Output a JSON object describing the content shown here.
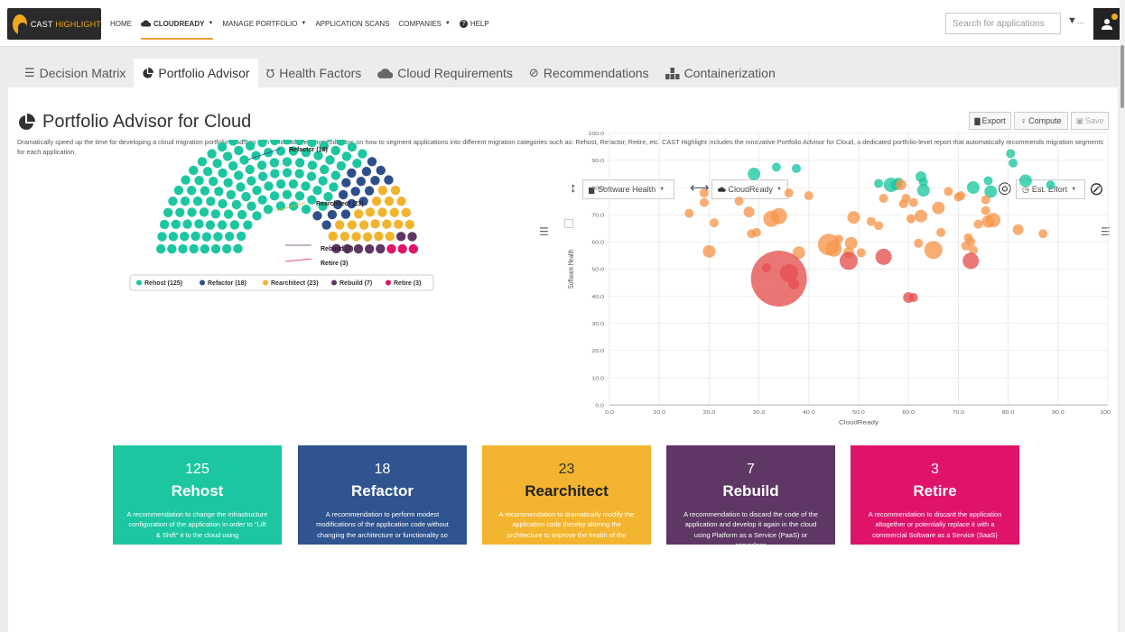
{
  "app": {
    "logo_text_a": "CAST",
    "logo_text_b": "HIGHLIGHT"
  },
  "nav": {
    "items": [
      {
        "label": "HOME",
        "dropdown": false
      },
      {
        "label": "CLOUDREADY",
        "dropdown": true,
        "active": true
      },
      {
        "label": "MANAGE PORTFOLIO",
        "dropdown": true
      },
      {
        "label": "APPLICATION SCANS",
        "dropdown": false
      },
      {
        "label": "COMPANIES",
        "dropdown": true
      },
      {
        "label": "HELP",
        "dropdown": false
      }
    ],
    "search_placeholder": "Search for applications",
    "filter_label": "…"
  },
  "tabs": [
    {
      "label": "Decision Matrix",
      "icon": "sliders-icon"
    },
    {
      "label": "Portfolio Advisor",
      "icon": "pie-icon",
      "active": true
    },
    {
      "label": "Health Factors",
      "icon": "stethoscope-icon"
    },
    {
      "label": "Cloud Requirements",
      "icon": "cloud-icon"
    },
    {
      "label": "Recommendations",
      "icon": "check-circle-icon"
    },
    {
      "label": "Containerization",
      "icon": "container-icon"
    }
  ],
  "page": {
    "title": "Portfolio Advisor for Cloud",
    "description": "Dramatically speed up the time for developing a cloud migration portfolio roadmap with automatic recommendations on how to segment applications into different migration categories such as: Rehost, Refactor, Retire, etc. CAST Highlight includes the innovative Portfolio Advisor for Cloud, a dedicated portfolio-level report that automatically recommends migration segments for each application.",
    "export_label": "Export",
    "compute_label": "Compute",
    "save_label": "Save"
  },
  "controls": {
    "y_axis_select": "Software Health",
    "x_axis_select": "CloudReady",
    "size_select": "Est. Effort"
  },
  "colors": {
    "rehost": "#1cc6a0",
    "refactor": "#2f4f8c",
    "rearchitect": "#f1b42f",
    "rebuild": "#5e3764",
    "retire": "#e0136b"
  },
  "chart_data": [
    {
      "type": "parliament",
      "series": [
        {
          "name": "Rehost",
          "label": "Rehost (125)",
          "value": 125
        },
        {
          "name": "Refactor",
          "label": "Refactor (18)",
          "value": 18
        },
        {
          "name": "Rearchitect",
          "label": "Rearchitect (23)",
          "value": 23
        },
        {
          "name": "Rebuild",
          "label": "Rebuild (7)",
          "value": 7
        },
        {
          "name": "Retire",
          "label": "Retire (3)",
          "value": 3
        }
      ],
      "legend": "bottom"
    },
    {
      "type": "scatter",
      "xlabel": "CloudReady",
      "ylabel": "Software Health",
      "xlim": [
        0,
        100
      ],
      "ylim": [
        0,
        100
      ],
      "xticks": [
        "0.0",
        "10.0",
        "20.0",
        "30.0",
        "40.0",
        "50.0",
        "60.0",
        "70.0",
        "80.0",
        "90.0",
        "100.0"
      ],
      "yticks": [
        "0.0",
        "10.0",
        "20.0",
        "30.0",
        "40.0",
        "50.0",
        "60.0",
        "70.0",
        "80.0",
        "90.0",
        "100.0"
      ],
      "grid": true,
      "series": [
        {
          "name": "Rehost",
          "points": [
            [
              29,
              85,
              7
            ],
            [
              33.5,
              87.5,
              5
            ],
            [
              37.5,
              87,
              5
            ],
            [
              54,
              81.5,
              5
            ],
            [
              56.5,
              81,
              8
            ],
            [
              57.5,
              81,
              6
            ],
            [
              58,
              82,
              5
            ],
            [
              62.5,
              84,
              6
            ],
            [
              63,
              82,
              5
            ],
            [
              63,
              79,
              7
            ],
            [
              73,
              80,
              7
            ],
            [
              76,
              82.5,
              5
            ],
            [
              76.5,
              78.5,
              7
            ],
            [
              80.5,
              92.5,
              5
            ],
            [
              81,
              89,
              5
            ],
            [
              83.5,
              82.5,
              7
            ],
            [
              88.5,
              81,
              5
            ]
          ]
        },
        {
          "name": "Rearchitect",
          "points": [
            [
              16,
              70.5,
              5
            ],
            [
              19,
              78,
              5
            ],
            [
              19,
              74.5,
              5
            ],
            [
              20,
              56.5,
              7
            ],
            [
              21,
              67,
              5
            ],
            [
              26,
              75,
              5
            ],
            [
              28,
              71,
              6
            ],
            [
              28.5,
              63,
              5
            ],
            [
              29.5,
              63.5,
              5
            ],
            [
              32.5,
              68.5,
              9
            ],
            [
              34,
              69.5,
              9
            ],
            [
              36,
              78,
              5
            ],
            [
              38,
              56,
              7
            ],
            [
              40,
              77,
              5
            ],
            [
              44,
              59,
              12
            ],
            [
              45,
              57.5,
              9
            ],
            [
              46,
              61,
              5
            ],
            [
              48,
              56,
              6
            ],
            [
              48.5,
              59.5,
              7
            ],
            [
              49,
              69,
              7
            ],
            [
              50.5,
              56,
              5
            ],
            [
              52.5,
              67.5,
              5
            ],
            [
              54,
              66,
              5
            ],
            [
              55,
              76,
              5
            ],
            [
              58.5,
              81,
              6
            ],
            [
              59,
              74,
              5
            ],
            [
              59.5,
              76,
              5
            ],
            [
              60.5,
              68.5,
              5
            ],
            [
              61,
              74.5,
              5
            ],
            [
              62,
              59.5,
              5
            ],
            [
              62.5,
              69.5,
              7
            ],
            [
              65,
              57,
              10
            ],
            [
              66,
              72.5,
              7
            ],
            [
              66.5,
              63.5,
              5
            ],
            [
              68,
              78.5,
              5
            ],
            [
              70,
              76.5,
              5
            ],
            [
              70.5,
              77,
              5
            ],
            [
              72,
              61.5,
              5
            ],
            [
              73,
              57,
              5
            ],
            [
              74,
              66.5,
              5
            ],
            [
              75.5,
              71.5,
              5
            ],
            [
              75.5,
              75.5,
              5
            ],
            [
              76,
              67.5,
              7
            ],
            [
              77,
              68,
              8
            ],
            [
              82,
              64.5,
              6
            ],
            [
              87,
              63,
              5
            ],
            [
              71.5,
              58.5,
              5
            ],
            [
              72.5,
              60,
              5
            ]
          ]
        },
        {
          "name": "Rebuild",
          "points": [
            [
              34,
              46.5,
              31
            ],
            [
              36,
              48.5,
              10
            ],
            [
              37,
              44.5,
              6
            ],
            [
              31.5,
              50.5,
              5
            ],
            [
              48,
              53,
              10
            ],
            [
              55,
              54.5,
              9
            ],
            [
              60,
              39.5,
              6
            ],
            [
              61,
              39.5,
              5
            ],
            [
              72.5,
              53,
              9
            ]
          ]
        }
      ]
    }
  ],
  "cards": [
    {
      "count": "125",
      "title": "Rehost",
      "desc": "A recommendation to change the infrastructure configuration of the application in order to \"Lift & Shift\" it to the cloud using",
      "color": "#1cc6a0"
    },
    {
      "count": "18",
      "title": "Refactor",
      "desc": "A recommendation to perform modest modifications of the application code without changing the architecture or functionality so",
      "color": "#2f548f"
    },
    {
      "count": "23",
      "title": "Rearchitect",
      "desc": "A recommendation to dramatically modify the application code thereby altering the architecture to improve the health of the",
      "color": "#f3b52f"
    },
    {
      "count": "7",
      "title": "Rebuild",
      "desc": "A recommendation to discard the code of the application and develop it again in the cloud using Platform as a Service (PaaS) or serverless",
      "color": "#5e3764"
    },
    {
      "count": "3",
      "title": "Retire",
      "desc": "A recommendation to discard the application altogether or potentially replace it with a commercial Software as a Service (SaaS)",
      "color": "#e0136b"
    }
  ]
}
